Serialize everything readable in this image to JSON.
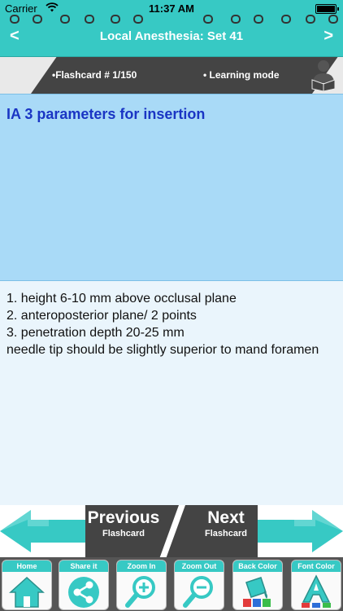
{
  "status": {
    "carrier": "Carrier",
    "time": "11:37 AM"
  },
  "header": {
    "title": "Local Anesthesia: Set 41",
    "prev_label": "<",
    "next_label": ">"
  },
  "info": {
    "flashcard": "•Flashcard #  1/150",
    "mode": "• Learning mode"
  },
  "question": "IA 3 parameters for insertion",
  "answer": {
    "lines": [
      "1. height 6-10 mm above occlusal plane",
      "2. anteroposterior plane/ 2 points",
      "3. penetration depth 20-25 mm"
    ],
    "note": "needle tip should be slightly superior to mand foramen"
  },
  "nav": {
    "prev_big": "Previous",
    "prev_small": "Flashcard",
    "next_big": "Next",
    "next_small": "Flashcard"
  },
  "toolbar": {
    "home": "Home",
    "share": "Share it",
    "zoom_in": "Zoom In",
    "zoom_out": "Zoom Out",
    "back_color": "Back Color",
    "font_color": "Font Color"
  },
  "colors": {
    "accent": "#37c9c4",
    "question_bg": "#a9daf7",
    "question_text": "#1a35c4",
    "dark": "#444444"
  }
}
